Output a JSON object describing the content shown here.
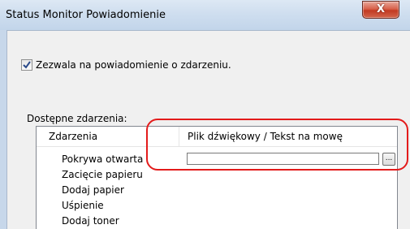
{
  "window": {
    "title": "Status Monitor Powiadomienie",
    "close_symbol": "X"
  },
  "notify_checkbox": {
    "label": "Zezwala na powiadomienie o zdarzeniu.",
    "checked": true
  },
  "events_group": {
    "label": "Dostępne zdarzenia:"
  },
  "table": {
    "columns": [
      "Zdarzenia",
      "Plik dźwiękowy / Tekst na mowę"
    ],
    "rows": [
      {
        "event": "Pokrywa otwarta",
        "sound_value": ""
      },
      {
        "event": "Zacięcie papieru"
      },
      {
        "event": "Dodaj papier"
      },
      {
        "event": "Uśpienie"
      },
      {
        "event": "Dodaj toner"
      }
    ],
    "browse_label": "..."
  },
  "colors": {
    "highlight": "#e31b1b",
    "close_button": "#c23a22"
  }
}
